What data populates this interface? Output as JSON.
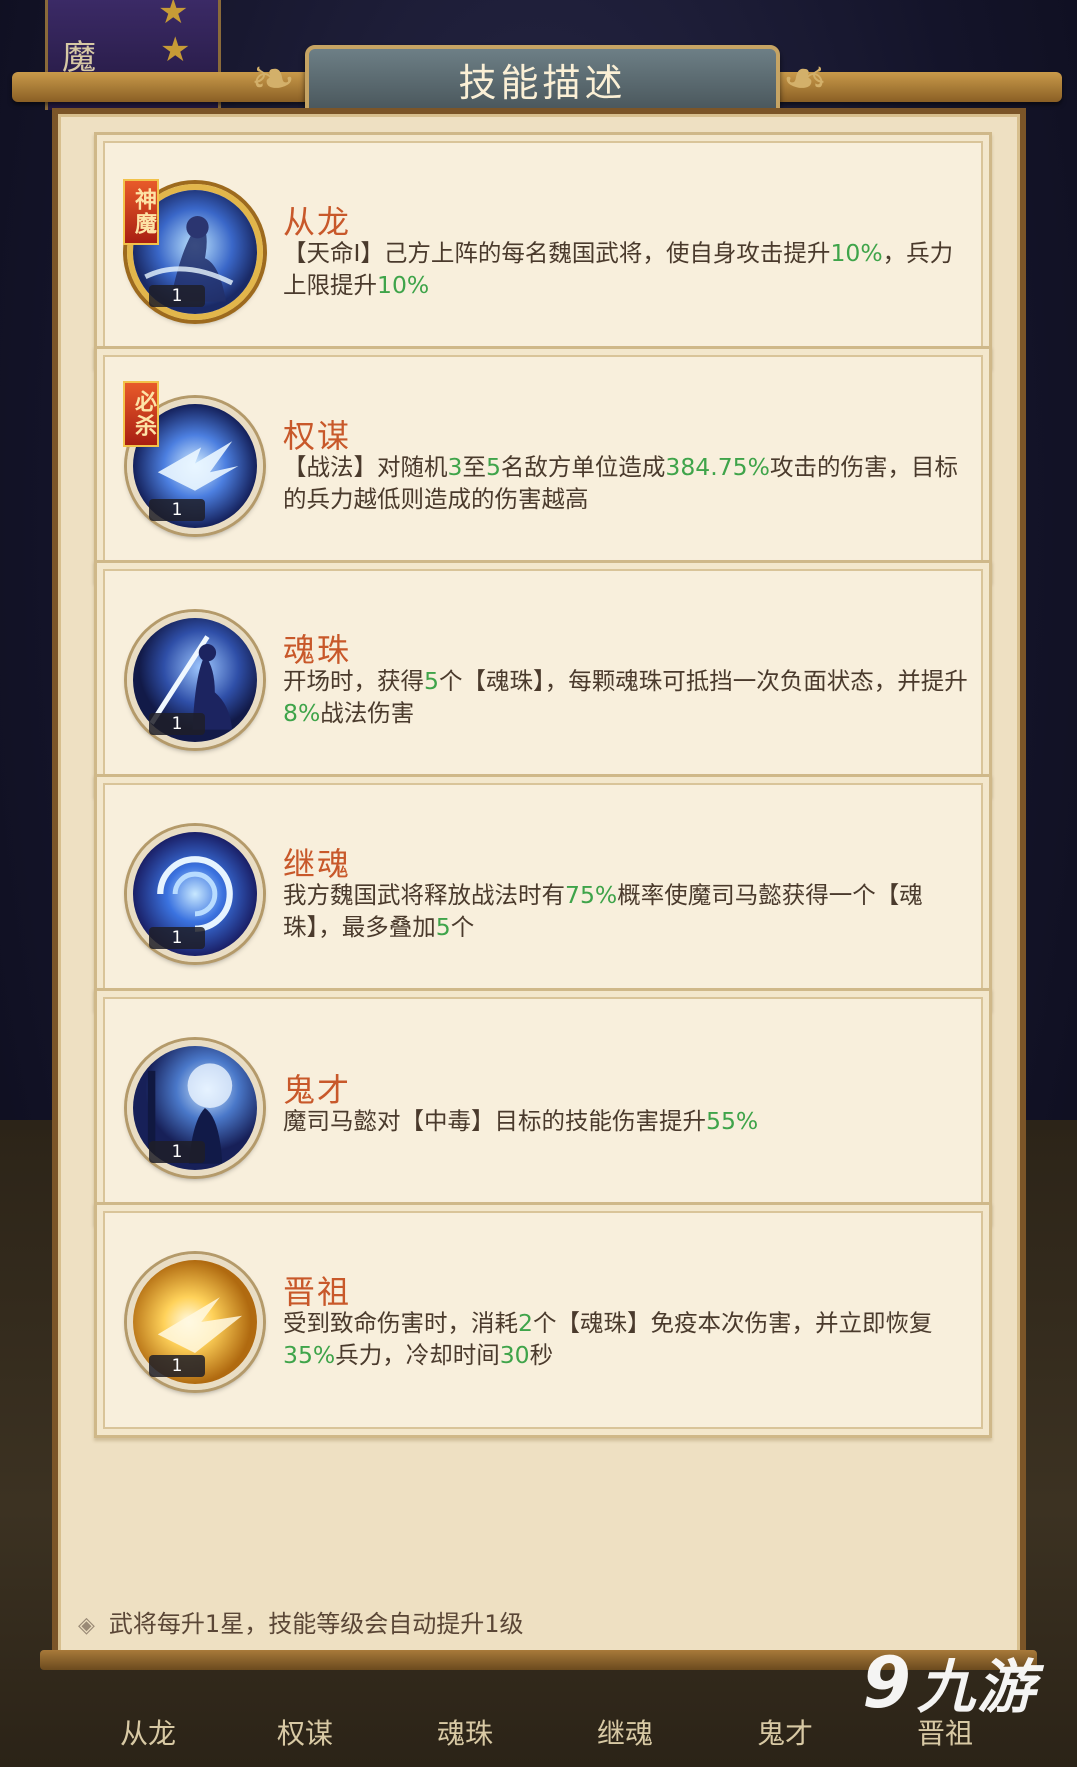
{
  "background": {
    "top_tab_char": "魔",
    "bottom_tabs": [
      "从龙",
      "权谋",
      "魂珠",
      "继魂",
      "鬼才",
      "晋祖"
    ]
  },
  "watermark": {
    "mark": "9",
    "text": "九游"
  },
  "title": "技能描述",
  "skills": [
    {
      "name": "从龙",
      "tag": "神魔",
      "level": "1",
      "desc": [
        {
          "t": "【天命Ⅰ】己方上阵的每名魏国武将，使自身攻击提升"
        },
        {
          "t": "10%",
          "g": true
        },
        {
          "t": "，兵力上限提升"
        },
        {
          "t": "10%",
          "g": true
        }
      ]
    },
    {
      "name": "权谋",
      "tag": "必杀",
      "level": "1",
      "desc": [
        {
          "t": "【战法】对随机"
        },
        {
          "t": "3",
          "g": true
        },
        {
          "t": "至"
        },
        {
          "t": "5",
          "g": true
        },
        {
          "t": "名敌方单位造成"
        },
        {
          "t": "384.75%",
          "g": true
        },
        {
          "t": "攻击的伤害，目标的兵力越低则造成的伤害越高"
        }
      ]
    },
    {
      "name": "魂珠",
      "tag": "",
      "level": "1",
      "desc": [
        {
          "t": "开场时，获得"
        },
        {
          "t": "5",
          "g": true
        },
        {
          "t": "个【魂珠】，每颗魂珠可抵挡一次负面状态，并提升"
        },
        {
          "t": "8%",
          "g": true
        },
        {
          "t": "战法伤害"
        }
      ]
    },
    {
      "name": "继魂",
      "tag": "",
      "level": "1",
      "desc": [
        {
          "t": "我方魏国武将释放战法时有"
        },
        {
          "t": "75%",
          "g": true
        },
        {
          "t": "概率使魔司马懿获得一个【魂珠】，最多叠加"
        },
        {
          "t": "5",
          "g": true
        },
        {
          "t": "个"
        }
      ]
    },
    {
      "name": "鬼才",
      "tag": "",
      "level": "1",
      "desc": [
        {
          "t": "魔司马懿对【中毒】目标的技能伤害提升"
        },
        {
          "t": "55%",
          "g": true
        }
      ]
    },
    {
      "name": "晋祖",
      "tag": "",
      "level": "1",
      "desc": [
        {
          "t": "受到致命伤害时，消耗"
        },
        {
          "t": "2",
          "g": true
        },
        {
          "t": "个【魂珠】免疫本次伤害，并立即恢复"
        },
        {
          "t": "35%",
          "g": true
        },
        {
          "t": "兵力，冷却时间"
        },
        {
          "t": "30",
          "g": true
        },
        {
          "t": "秒"
        }
      ]
    }
  ],
  "footer_note": "武将每升1星，技能等级会自动提升1级",
  "colors": {
    "name": "#c8582a",
    "highlight": "#3fa44a",
    "text": "#4a3a2c",
    "panel": "#eee0c2",
    "card": "#f8efdc"
  },
  "icons": [
    "dragon-hero-icon",
    "flying-birds-icon",
    "swordsman-icon",
    "vortex-orb-icon",
    "moonlit-figure-icon",
    "golden-burst-icon"
  ]
}
